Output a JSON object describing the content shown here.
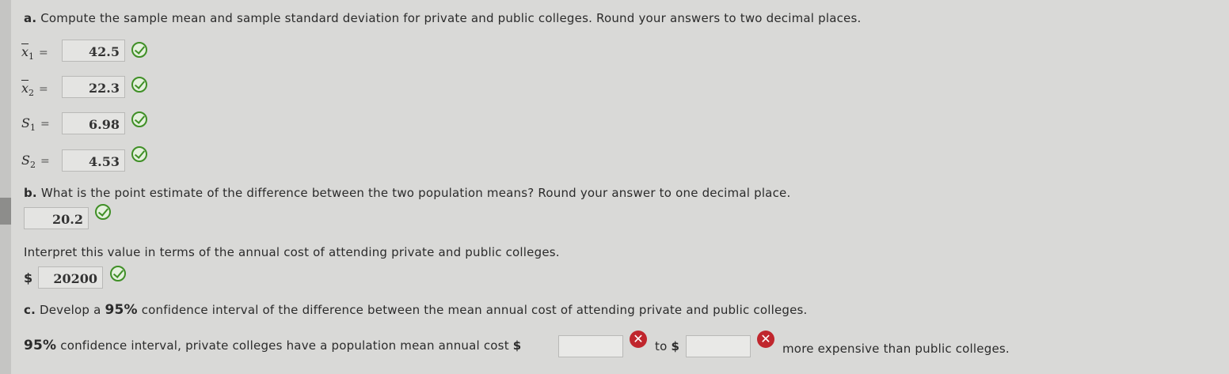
{
  "part_a": {
    "prompt_letter": "a.",
    "prompt": "Compute the sample mean and sample standard deviation for private and public colleges. Round your answers to two decimal places.",
    "rows": [
      {
        "symbol": "x",
        "subscript": "1",
        "value": "42.5"
      },
      {
        "symbol": "x",
        "subscript": "2",
        "value": "22.3"
      },
      {
        "symbol": "S",
        "subscript": "1",
        "value": "6.98"
      },
      {
        "symbol": "S",
        "subscript": "2",
        "value": "4.53"
      }
    ],
    "equals": "="
  },
  "part_b": {
    "prompt_letter": "b.",
    "prompt": "What is the point estimate of the difference between the two population means? Round your answer to one decimal place.",
    "answer": "20.2",
    "interpret_prompt": "Interpret this value in terms of the annual cost of attending private and public colleges.",
    "currency": "$",
    "interpret_answer": "20200"
  },
  "part_c": {
    "prompt_letter": "c.",
    "prompt_pre": "Develop a",
    "confidence": "95%",
    "prompt_post": "confidence interval of the difference between the mean annual cost of attending private and public colleges.",
    "ci_pre": "confidence interval, private colleges have a population mean annual cost",
    "currency": "$",
    "to": "to",
    "ci_post": "more expensive than public colleges.",
    "lower": "",
    "upper": "",
    "x_glyph": "✕"
  },
  "colors": {
    "correct": "#3f8f26",
    "incorrect": "#c0262d"
  }
}
